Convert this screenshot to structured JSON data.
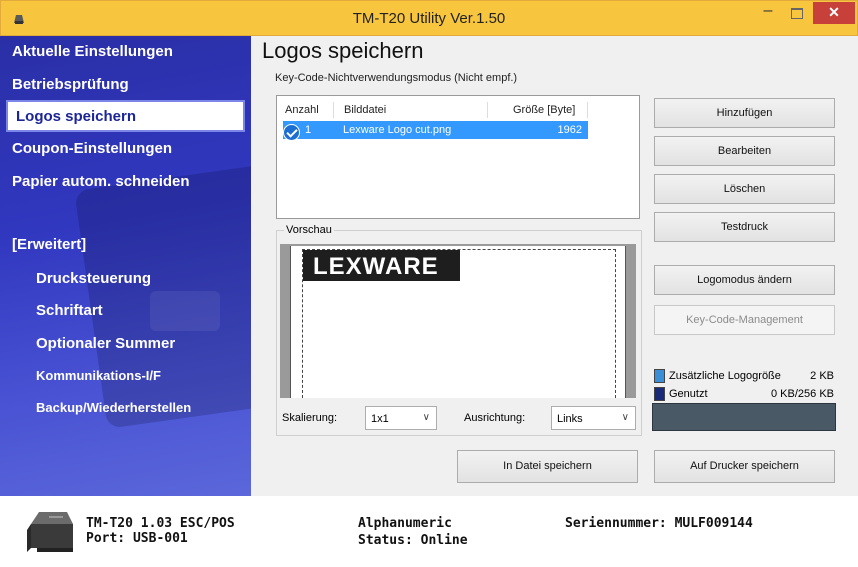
{
  "window": {
    "title": "TM-T20 Utility Ver.1.50",
    "min_glyph": "–",
    "close_glyph": "✕"
  },
  "sidebar": {
    "items": [
      {
        "label": "Aktuelle Einstellungen"
      },
      {
        "label": "Betriebsprüfung"
      },
      {
        "label": "Logos speichern",
        "selected": true
      },
      {
        "label": "Coupon-Einstellungen"
      },
      {
        "label": "Papier autom. schneiden"
      },
      {
        "label": "[Erweitert]"
      },
      {
        "label": "Drucksteuerung"
      },
      {
        "label": "Schriftart"
      },
      {
        "label": "Optionaler Summer"
      },
      {
        "label": "Kommunikations-I/F"
      },
      {
        "label": "Backup/Wiederherstellen"
      }
    ]
  },
  "main": {
    "heading": "Logos speichern",
    "keycode_label": "Key-Code-Nichtverwendungsmodus (Nicht empf.)",
    "table": {
      "headers": {
        "count": "Anzahl",
        "file": "Bilddatei",
        "size": "Größe [Byte]"
      },
      "rows": [
        {
          "count": "1",
          "file": "Lexware Logo cut.png",
          "size": "1962",
          "checked": true
        }
      ]
    },
    "preview": {
      "label": "Vorschau",
      "logo_text": "LEXWARE"
    },
    "scaling": {
      "label": "Skalierung:",
      "value": "1x1"
    },
    "alignment": {
      "label": "Ausrichtung:",
      "value": "Links"
    },
    "buttons": {
      "add": "Hinzufügen",
      "edit": "Bearbeiten",
      "delete": "Löschen",
      "testprint": "Testdruck",
      "logomode": "Logomodus ändern",
      "keycode": "Key-Code-Management",
      "save_file": "In Datei speichern",
      "save_printer": "Auf Drucker speichern"
    },
    "memory": {
      "additional_label": "Zusätzliche Logogröße",
      "additional_value": "2 KB",
      "used_label": "Genutzt",
      "used_value": "0 KB/256 KB",
      "used_fraction": 0.0,
      "colors": {
        "additional": "#3b8fd6",
        "used": "#1a2a7a",
        "bar": "#4a5966"
      }
    }
  },
  "status": {
    "model": "TM-T20 1.03 ESC/POS",
    "port": "Port: USB-001",
    "mode": "Alphanumeric",
    "state": "Status: Online",
    "serial": "Seriennummer: MULF009144"
  },
  "colors": {
    "titlebar": "#f8c53e",
    "sidebar": "#3138c0",
    "selection": "#3399ff",
    "close": "#c7403a"
  }
}
